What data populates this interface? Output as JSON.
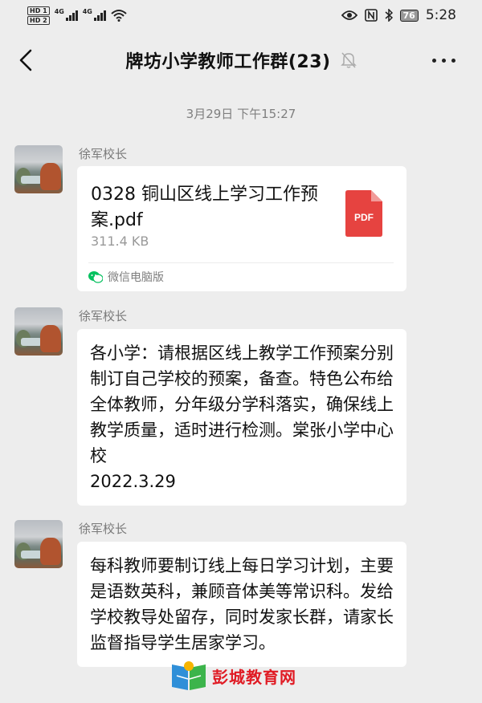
{
  "status_bar": {
    "hd1": "HD 1",
    "hd2": "HD 2",
    "net1": "4G",
    "net2": "4G",
    "battery": "76",
    "time": "5:28"
  },
  "nav": {
    "title": "牌坊小学教师工作群(23)",
    "back_icon": "chevron-left-icon",
    "mute_icon": "bell-muted-icon",
    "more_icon": "more-dots-icon"
  },
  "timestamp": "3月29日 下午15:27",
  "messages": [
    {
      "sender": "徐军校长",
      "type": "file",
      "file_name": "0328 铜山区线上学习工作预案.pdf",
      "file_size": "311.4 KB",
      "file_icon_label": "PDF",
      "source": "微信电脑版"
    },
    {
      "sender": "徐军校长",
      "type": "text",
      "text": "各小学：请根据区线上教学工作预案分别制订自己学校的预案，备查。特色公布给全体教师，分年级分学科落实，确保线上教学质量，适时进行检测。棠张小学中心校\n2022.3.29"
    },
    {
      "sender": "徐军校长",
      "type": "text",
      "text": "每科教师要制订线上每日学习计划，主要是语数英科，兼顾音体美等常识科。发给学校教导处留存，同时发家长群，请家长监督指导学生居家学习。"
    }
  ],
  "watermark": {
    "text": "彭城教育网"
  },
  "colors": {
    "background": "#ededed",
    "bubble": "#ffffff",
    "pdf_red": "#e64340",
    "wechat_green": "#07c160",
    "watermark_red": "#e01b24"
  }
}
